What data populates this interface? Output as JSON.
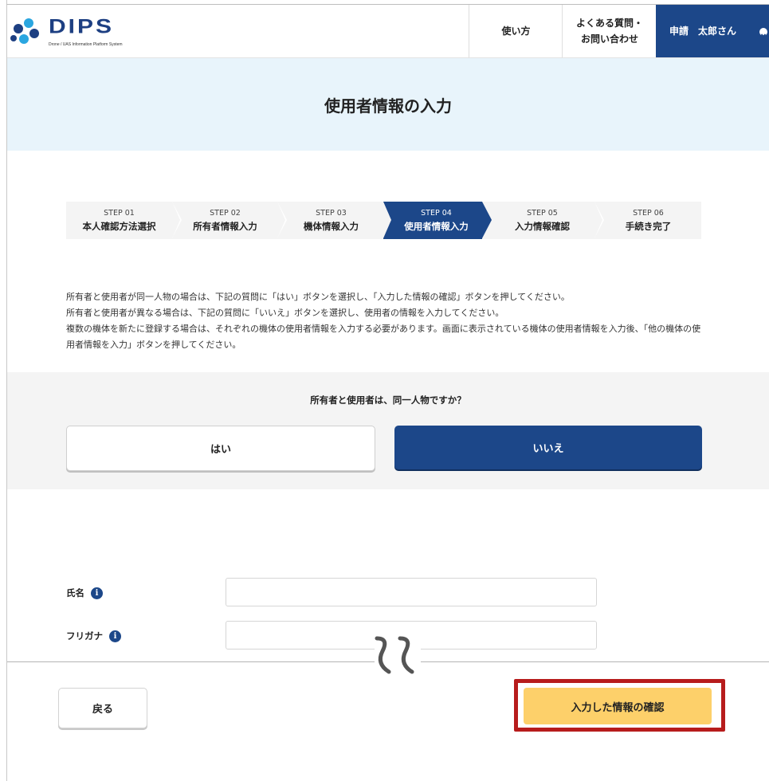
{
  "header": {
    "logo_text": "DIPS",
    "logo_subtitle": "Drone / UAS Information Platform System",
    "nav_howto": "使い方",
    "nav_faq_line1": "よくある質問・",
    "nav_faq_line2": "お問い合わせ",
    "user_name": "申請　太郎さん"
  },
  "hero": {
    "title": "使用者情報の入力"
  },
  "steps": [
    {
      "num": "STEP 01",
      "label": "本人確認方法選択"
    },
    {
      "num": "STEP 02",
      "label": "所有者情報入力"
    },
    {
      "num": "STEP 03",
      "label": "機体情報入力"
    },
    {
      "num": "STEP 04",
      "label": "使用者情報入力",
      "active": true
    },
    {
      "num": "STEP 05",
      "label": "入力情報確認"
    },
    {
      "num": "STEP 06",
      "label": "手続き完了"
    }
  ],
  "instructions": [
    "所有者と使用者が同一人物の場合は、下記の質問に「はい」ボタンを選択し、「入力した情報の確認」ボタンを押してください。",
    "所有者と使用者が異なる場合は、下記の質問に「いいえ」ボタンを選択し、使用者の情報を入力してください。",
    "複数の機体を新たに登録する場合は、それぞれの機体の使用者情報を入力する必要があります。画面に表示されている機体の使用者情報を入力後、「他の機体の使用者情報を入力」ボタンを押してください。"
  ],
  "question": {
    "text": "所有者と使用者は、同一人物ですか？",
    "yes_label": "はい",
    "no_label": "いいえ",
    "selected": "いいえ"
  },
  "form": {
    "name_label": "氏名",
    "name_value": "",
    "kana_label": "フリガナ",
    "kana_value": ""
  },
  "footer": {
    "back_label": "戻る",
    "confirm_label": "入力した情報の確認"
  },
  "colors": {
    "brand_navy": "#1c4789",
    "hero_bg": "#e8f4fb",
    "confirm_yellow": "#fdd06a",
    "highlight_red": "#b71c1c"
  }
}
